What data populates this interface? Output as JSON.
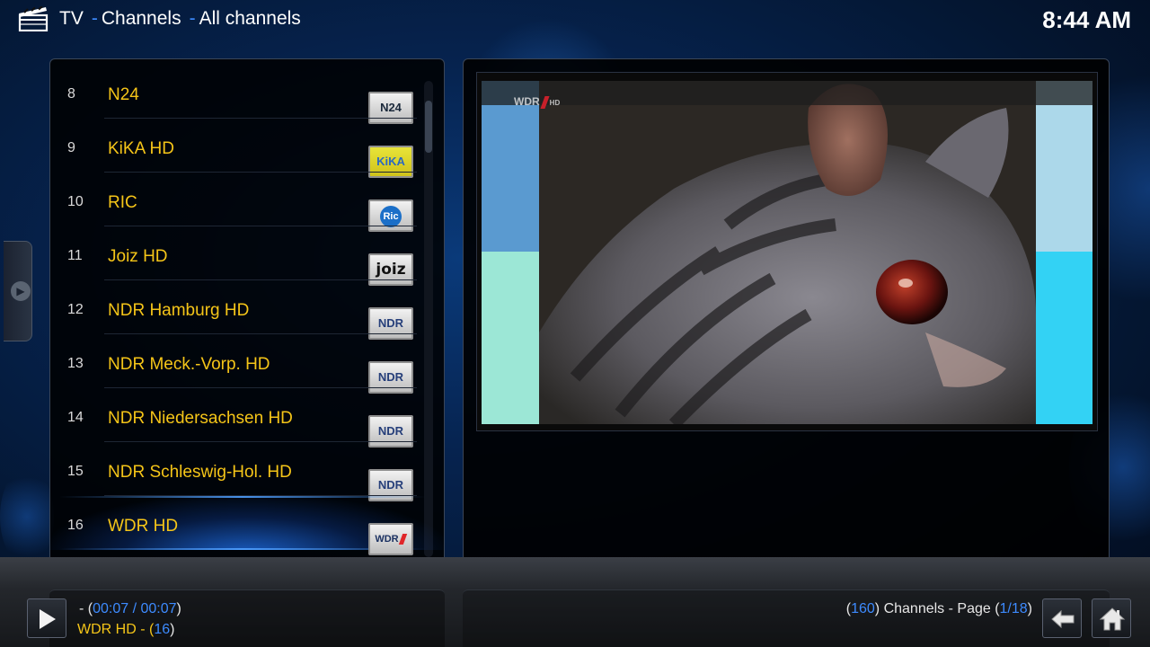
{
  "header": {
    "section": "TV",
    "crumb_1": "Channels",
    "crumb_2": "All channels",
    "separator": "-",
    "clock": "8:44 AM"
  },
  "channels": [
    {
      "number": "8",
      "name": "N24",
      "logo": "N24"
    },
    {
      "number": "9",
      "name": "KiKA HD",
      "logo": "KiKA"
    },
    {
      "number": "10",
      "name": "RIC",
      "logo": "Ric"
    },
    {
      "number": "11",
      "name": "Joiz HD",
      "logo": "joiz"
    },
    {
      "number": "12",
      "name": "NDR Hamburg HD",
      "logo": "NDR"
    },
    {
      "number": "13",
      "name": "NDR Meck.-Vorp. HD",
      "logo": "NDR"
    },
    {
      "number": "14",
      "name": "NDR Niedersachsen HD",
      "logo": "NDR"
    },
    {
      "number": "15",
      "name": "NDR Schleswig-Hol. HD",
      "logo": "NDR"
    },
    {
      "number": "16",
      "name": "WDR HD",
      "logo": "WDR",
      "selected": true
    }
  ],
  "video": {
    "watermark": "WDR",
    "watermark_suffix": "HD"
  },
  "player": {
    "time_prefix": "- (",
    "time_current": "00:07",
    "time_sep": " / ",
    "time_total": "00:07",
    "time_suffix": ")",
    "channel_name": "WDR HD",
    "channel_sep": " - (",
    "channel_number": "16",
    "channel_suffix": ")"
  },
  "status": {
    "open": "(",
    "count": "160",
    "label": ") Channels - Page (",
    "page": "1/18",
    "close": ")"
  },
  "colors": {
    "accent_blue": "#3d8bff",
    "channel_yellow": "#f5c518"
  }
}
